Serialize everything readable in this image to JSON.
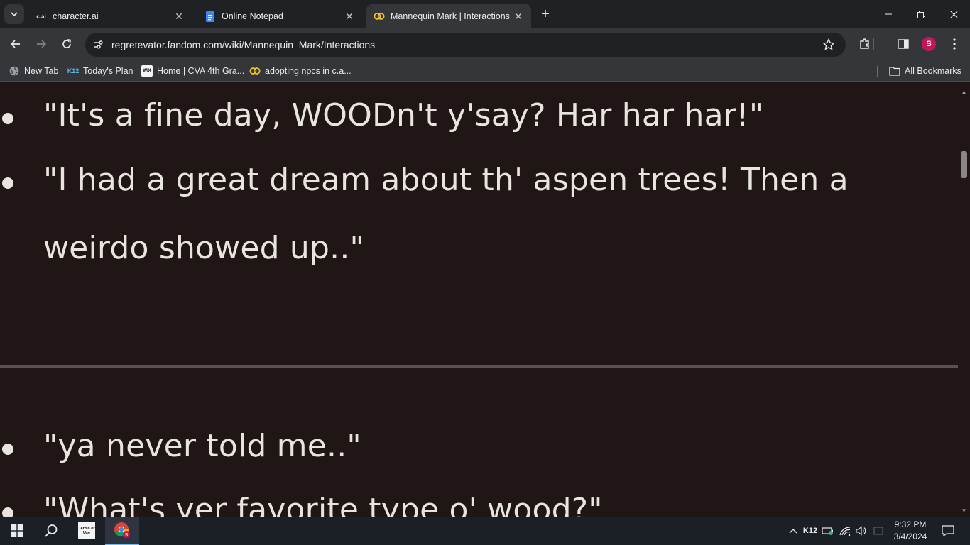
{
  "tabs": [
    {
      "title": "character.ai",
      "favicon": "cai-icon"
    },
    {
      "title": "Online Notepad",
      "favicon": "doc-icon"
    },
    {
      "title": "Mannequin Mark | Interactions |",
      "favicon": "fandom-rings-icon",
      "active": true
    }
  ],
  "address_bar": {
    "url": "regretevator.fandom.com/wiki/Mannequin_Mark/Interactions"
  },
  "profile": {
    "initial": "S",
    "color": "#c2185b"
  },
  "bookmarks": [
    {
      "label": "New Tab",
      "icon": "globe-icon"
    },
    {
      "label": "Today's Plan",
      "icon": "k12-icon"
    },
    {
      "label": "Home | CVA 4th Gra...",
      "icon": "wix-icon"
    },
    {
      "label": "adopting npcs in c.a...",
      "icon": "fandom-rings-icon"
    }
  ],
  "all_bookmarks_label": "All Bookmarks",
  "content": {
    "quotes_top": [
      "\"It's a fine day, WOODn't y'say? Har har har!\"",
      "\"I had a great dream about th' aspen trees! Then a",
      "weirdo showed up..\""
    ],
    "quotes_bottom": [
      "\"ya never told me..\"",
      "\"What's yer favorite type o' wood?\""
    ]
  },
  "taskbar": {
    "tos_label": "Terms of Use",
    "tray_k12": "K12",
    "time": "9:32 PM",
    "date": "3/4/2024"
  },
  "colors": {
    "page_bg": "#1f1615",
    "text": "#e8e4e0",
    "chrome_dark": "#202124",
    "chrome_toolbar": "#35363a"
  }
}
